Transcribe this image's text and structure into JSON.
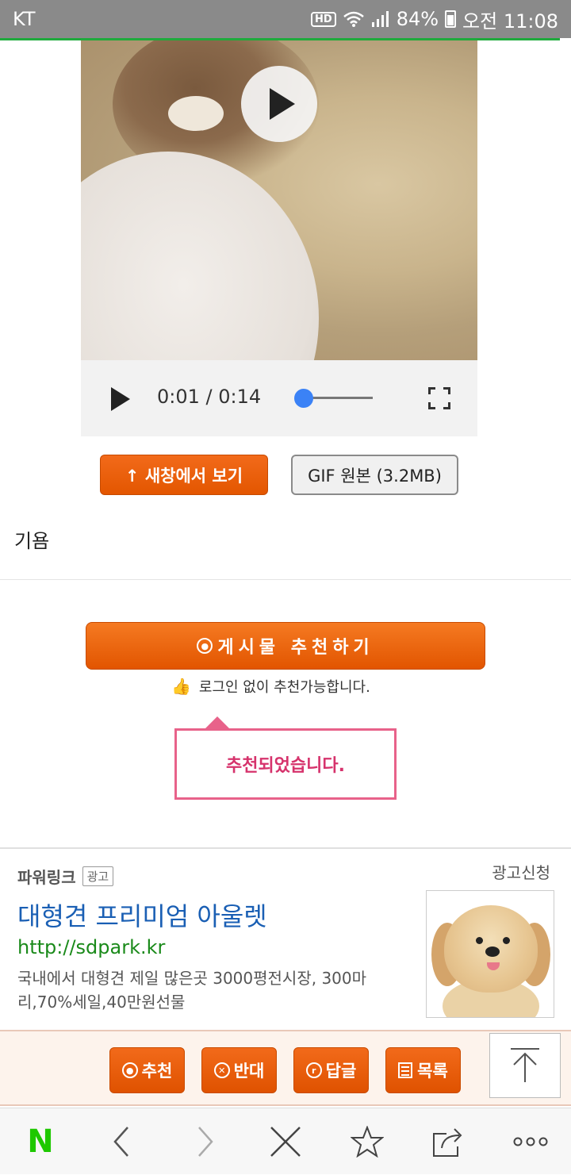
{
  "status_bar": {
    "carrier": "KT",
    "battery": "84%",
    "time": "오전 11:08",
    "hd_label": "HD"
  },
  "video": {
    "current_time": "0:01",
    "separator": " / ",
    "duration": "0:14",
    "progress": 0.07
  },
  "media_buttons": {
    "open_new_window": "↑ 새창에서 보기",
    "gif_original": "GIF 원본 (3.2MB)"
  },
  "post": {
    "body_text": "기욤"
  },
  "recommend": {
    "button_label": "게시물  추천하기",
    "icon_glyph": "◎",
    "no_login_note": "로그인 없이 추천가능합니다.",
    "tooltip": "추천되었습니다."
  },
  "ad": {
    "label": "파워링크",
    "badge": "광고",
    "apply": "광고신청",
    "title": "대형견 프리미엄 아울렛",
    "url": "http://sdpark.kr",
    "description": "국내에서 대형견 제일 많은곳 3000평전시장, 300마리,70%세일,40만원선물"
  },
  "actions": {
    "recommend": "추천",
    "oppose": "반대",
    "reply": "답글",
    "list": "목록"
  },
  "colors": {
    "accent_orange": "#e85a00",
    "link_blue": "#1a5fb4",
    "url_green": "#1a8a1a",
    "tooltip_pink": "#e8628a",
    "naver_green": "#1ec800"
  }
}
